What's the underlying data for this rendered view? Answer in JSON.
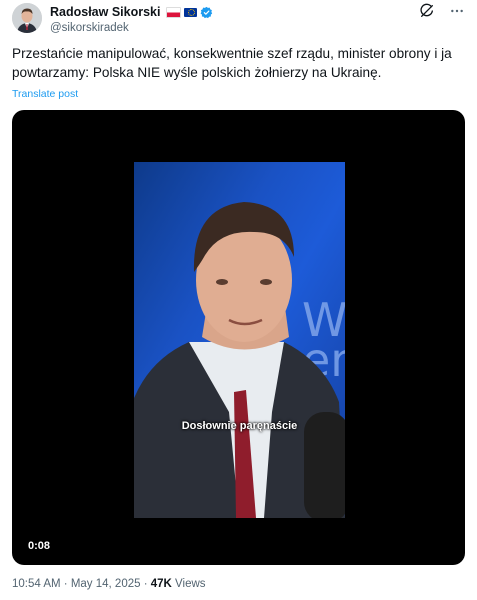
{
  "author": {
    "display_name": "Radosław Sikorski",
    "handle": "@sikorskiradek",
    "badges": [
      "flag-poland-icon",
      "flag-eu-icon",
      "verified-badge-icon"
    ]
  },
  "header_icons": [
    "grok-icon",
    "more-icon"
  ],
  "tweet": {
    "text": "Przestańcie manipulować, konsekwentnie szef rządu, minister obrony i ja powtarzamy: Polska NIE wyśle polskich żołnierzy na Ukrainę.",
    "translate_label": "Translate post"
  },
  "video": {
    "subtitle": "Dosłownie paręnaście",
    "duration": "0:08",
    "background_text": "We en"
  },
  "meta": {
    "time": "10:54 AM",
    "separator1": " · ",
    "date": "May 14, 2025",
    "separator2": " · ",
    "views_count": "47K",
    "views_label": " Views"
  },
  "colors": {
    "link": "#1d9bf0",
    "secondary_text": "#536471",
    "primary_text": "#0f1419",
    "verified": "#1d9bf0"
  }
}
